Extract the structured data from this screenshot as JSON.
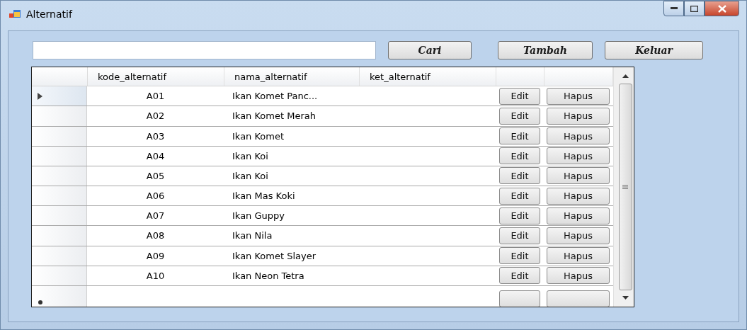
{
  "window": {
    "title": "Alternatif"
  },
  "buttons": [
    "Cari",
    "Tambah",
    "Keluar"
  ],
  "table": {
    "columns": [
      "kode_alternatif",
      "nama_alternatif",
      "ket_alternatif"
    ],
    "rows": [
      {
        "kode": "A01",
        "nama": "Ikan Komet Panc...",
        "edit": "Edit",
        "hapus": "Hapus",
        "selected": true
      },
      {
        "kode": "A02",
        "nama": "Ikan Komet Merah",
        "edit": "Edit",
        "hapus": "Hapus",
        "selected": false
      },
      {
        "kode": "A03",
        "nama": "Ikan Komet",
        "edit": "Edit",
        "hapus": "Hapus",
        "selected": false
      },
      {
        "kode": "A04",
        "nama": "Ikan Koi",
        "edit": "Edit",
        "hapus": "Hapus",
        "selected": false
      },
      {
        "kode": "A05",
        "nama": "Ikan Koi",
        "edit": "Edit",
        "hapus": "Hapus",
        "selected": false
      },
      {
        "kode": "A06",
        "nama": "Ikan Mas Koki",
        "edit": "Edit",
        "hapus": "Hapus",
        "selected": false
      },
      {
        "kode": "A07",
        "nama": "Ikan Guppy",
        "edit": "Edit",
        "hapus": "Hapus",
        "selected": false
      },
      {
        "kode": "A08",
        "nama": "Ikan Nila",
        "edit": "Edit",
        "hapus": "Hapus",
        "selected": false
      },
      {
        "kode": "A09",
        "nama": "Ikan Komet Slayer",
        "edit": "Edit",
        "hapus": "Hapus",
        "selected": false
      },
      {
        "kode": "A10",
        "nama": "Ikan Neon Tetra",
        "edit": "Edit",
        "hapus": "Hapus",
        "selected": false
      }
    ]
  }
}
